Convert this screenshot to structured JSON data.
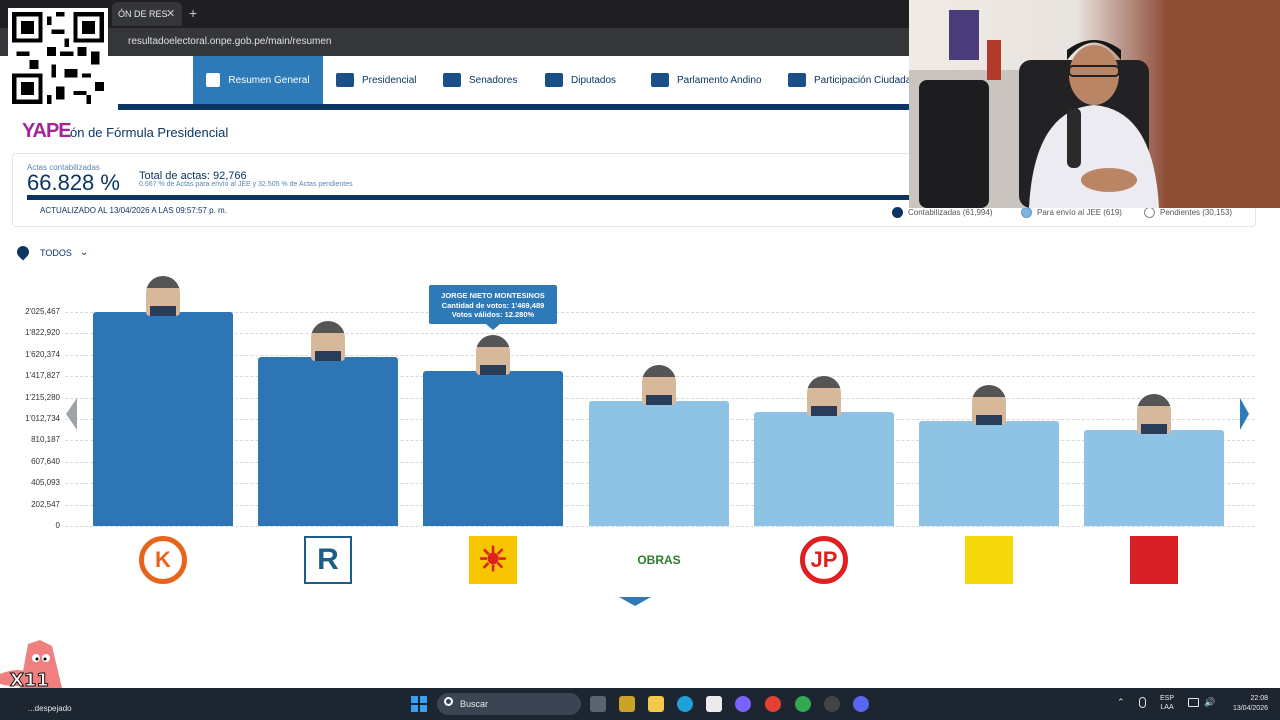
{
  "browser": {
    "tab_title": "ÓN DE RES",
    "url": "resultadoelectoral.onpe.gob.pe/main/resumen",
    "close": "✕",
    "new_tab": "+"
  },
  "nav": {
    "items": [
      {
        "label": "Resumen General",
        "active": true
      },
      {
        "label": "Presidencial"
      },
      {
        "label": "Senadores"
      },
      {
        "label": "Diputados"
      },
      {
        "label": "Parlamento Andino"
      },
      {
        "label": "Participación Ciudada"
      }
    ]
  },
  "overlay": {
    "yape": "YAPE",
    "x11": "X11"
  },
  "page": {
    "title": "ón de Fórmula Presidencial"
  },
  "summary": {
    "actas_label": "Actas contabilizadas",
    "actas_pct": "66.828 %",
    "total_actas": "Total de actas: 92,766",
    "detail": "0.667 % de Actas para envío al JEE y 32.505 % de Actas pendientes",
    "updated": "ACTUALIZADO AL 13/04/2026 A LAS 09:57:57 p. m.",
    "progress_contabilizadas": 0.66828,
    "progress_jee": 0.00667,
    "legend": [
      {
        "label": "Contabilizadas (61,994)",
        "color": "#0d3563"
      },
      {
        "label": "Para envío al JEE (619)",
        "color": "#7fb2dc"
      },
      {
        "label": "Pendientes (30,153)",
        "color": "#ffffff"
      }
    ]
  },
  "filter": {
    "label": "TODOS",
    "chevron": "⌄"
  },
  "chart_data": {
    "type": "bar",
    "ylim": [
      0,
      2025467
    ],
    "y_ticks": [
      "2'025,467",
      "1'822,920",
      "1'620,374",
      "1'417,827",
      "1'215,280",
      "1'012,734",
      "810,187",
      "607,640",
      "405,093",
      "202,547",
      "0"
    ],
    "y_tick_values": [
      2025467,
      1822920,
      1620374,
      1417827,
      1215280,
      1012734,
      810187,
      607640,
      405093,
      202547,
      0
    ],
    "values": [
      2025467,
      1597000,
      1469489,
      1180000,
      1080000,
      990000,
      910000
    ],
    "colors": [
      "#2e75b6",
      "#2e75b6",
      "#2e75b6",
      "#8ec3e6",
      "#8ec3e6",
      "#8ec3e6",
      "#8ec3e6"
    ],
    "logos": [
      {
        "text": "K",
        "fg": "#e8641b",
        "bg": "#ffffff",
        "shape": "circle"
      },
      {
        "text": "R",
        "fg": "#1b5e8a",
        "bg": "#ffffff",
        "shape": "square"
      },
      {
        "text": "☀",
        "fg": "#e02020",
        "bg": "#f7c600",
        "shape": "square"
      },
      {
        "text": "OBRAS",
        "fg": "#2d7d2d",
        "bg": "#ffffff",
        "shape": "text"
      },
      {
        "text": "JP",
        "fg": "#e02020",
        "bg": "#ffffff",
        "shape": "circle"
      },
      {
        "text": "",
        "fg": "#222222",
        "bg": "#f5d90a",
        "shape": "square"
      },
      {
        "text": "",
        "fg": "#ffffff",
        "bg": "#d81f26",
        "shape": "square"
      }
    ],
    "tooltip": {
      "name": "JORGE NIETO MONTESINOS",
      "votes": "Cantidad de votos: 1'469,489",
      "valid": "Votos válidos: 12.280%"
    }
  },
  "taskbar": {
    "weather": "...despejado",
    "search": "Buscar",
    "lang": "ESP",
    "lang2": "LAA",
    "time": "22:08",
    "date": "13/04/2026",
    "up_arrow": "⌃",
    "volume": "🔊"
  }
}
